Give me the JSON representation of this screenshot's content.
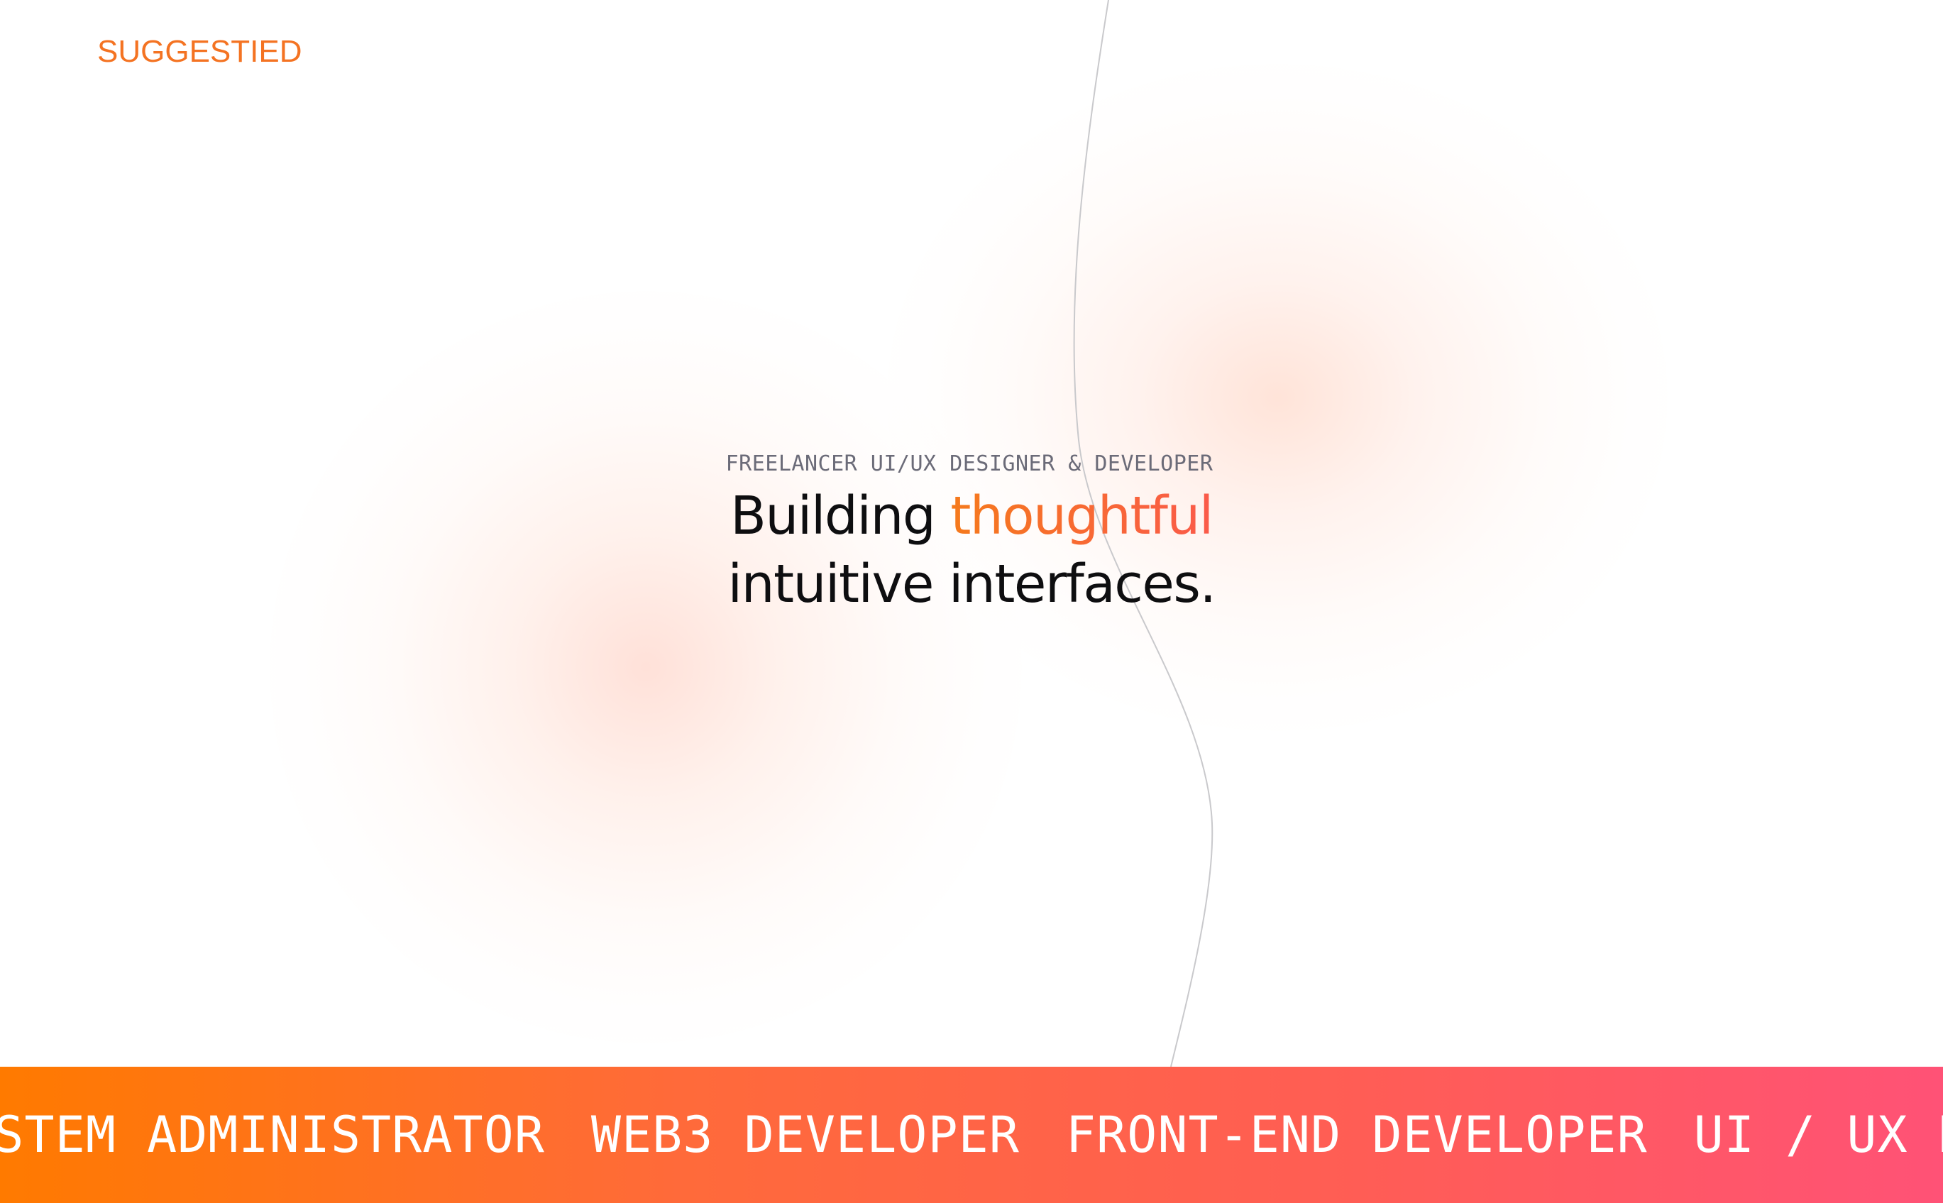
{
  "brand": {
    "logo_text": "SUGGESTIED",
    "accent_color": "#f47322"
  },
  "hero": {
    "eyebrow": "FREELANCER UI/UX DESIGNER & DEVELOPER",
    "headline_part1": "Building ",
    "headline_accent": "thoughtful",
    "headline_line2": "intuitive interfaces."
  },
  "ticker": {
    "gradient_start": "#ff7a00",
    "gradient_end": "#ff5276",
    "items": [
      "SYSTEM ADMINISTRATOR",
      "WEB3 DEVELOPER",
      "FRONT-END DEVELOPER",
      "UI / UX DESIGNER"
    ]
  }
}
